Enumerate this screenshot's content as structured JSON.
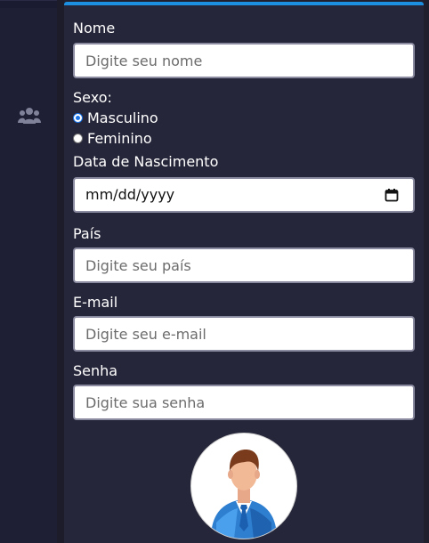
{
  "sidebar": {
    "items": [
      {
        "icon": "users-icon"
      }
    ]
  },
  "form": {
    "nome": {
      "label": "Nome",
      "placeholder": "Digite seu nome"
    },
    "sexo": {
      "label": "Sexo:",
      "options": [
        {
          "label": "Masculino",
          "checked": true
        },
        {
          "label": "Feminino",
          "checked": false
        }
      ]
    },
    "nascimento": {
      "label": "Data de Nascimento",
      "value": "mm/dd/yyyy"
    },
    "pais": {
      "label": "País",
      "placeholder": "Digite seu país"
    },
    "email": {
      "label": "E-mail",
      "placeholder": "Digite seu e-mail"
    },
    "senha": {
      "label": "Senha",
      "placeholder": "Digite sua senha"
    },
    "avatar": {
      "icon": "user-avatar-icon"
    }
  },
  "colors": {
    "accent": "#1c8fe0",
    "panel": "#26263a",
    "sidebar": "#1e1e34"
  }
}
